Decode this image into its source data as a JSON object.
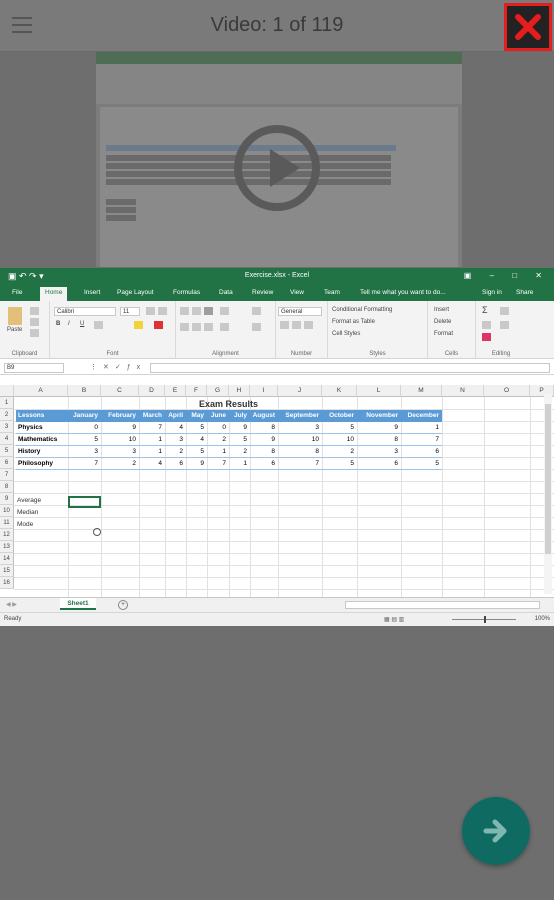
{
  "header": {
    "title": "Video: 1 of 119"
  },
  "excel": {
    "filename": "Exercise.xlsx - Excel",
    "tabs": [
      "File",
      "Home",
      "Insert",
      "Page Layout",
      "Formulas",
      "Data",
      "Review",
      "View",
      "Team"
    ],
    "tell_me": "Tell me what you want to do...",
    "sign_in": "Sign in",
    "share": "Share",
    "font_name": "Calibri",
    "font_size": "11",
    "number_format": "General",
    "conditional_formatting": "Conditional Formatting",
    "format_as_table": "Format as Table",
    "cell_styles": "Cell Styles",
    "insert": "Insert",
    "delete": "Delete",
    "format": "Format",
    "group_labels": [
      "Clipboard",
      "Font",
      "Alignment",
      "Number",
      "Styles",
      "Cells",
      "Editing"
    ],
    "paste_label": "Paste",
    "name_box": "B9",
    "columns": [
      "A",
      "B",
      "C",
      "D",
      "E",
      "F",
      "G",
      "H",
      "I",
      "J",
      "K",
      "L",
      "M",
      "N",
      "O",
      "P"
    ],
    "rows": [
      "1",
      "2",
      "3",
      "4",
      "5",
      "6",
      "7",
      "8",
      "9",
      "10",
      "11",
      "12",
      "13",
      "14",
      "15",
      "16"
    ],
    "table_title": "Exam Results",
    "header_row": [
      "Lessons",
      "January",
      "February",
      "March",
      "April",
      "May",
      "June",
      "July",
      "August",
      "September",
      "October",
      "November",
      "December"
    ],
    "data_rows": [
      [
        "Physics",
        "0",
        "9",
        "7",
        "4",
        "5",
        "0",
        "9",
        "8",
        "3",
        "5",
        "9",
        "1"
      ],
      [
        "Mathematics",
        "5",
        "10",
        "1",
        "3",
        "4",
        "2",
        "5",
        "9",
        "10",
        "10",
        "8",
        "7"
      ],
      [
        "History",
        "3",
        "3",
        "1",
        "2",
        "5",
        "1",
        "2",
        "8",
        "8",
        "2",
        "3",
        "6"
      ],
      [
        "Philosophy",
        "7",
        "2",
        "4",
        "6",
        "9",
        "7",
        "1",
        "6",
        "7",
        "5",
        "6",
        "5"
      ]
    ],
    "stat_labels": [
      "Average",
      "Median",
      "Mode"
    ],
    "sheet_name": "Sheet1",
    "status": "Ready",
    "zoom": "100%"
  }
}
